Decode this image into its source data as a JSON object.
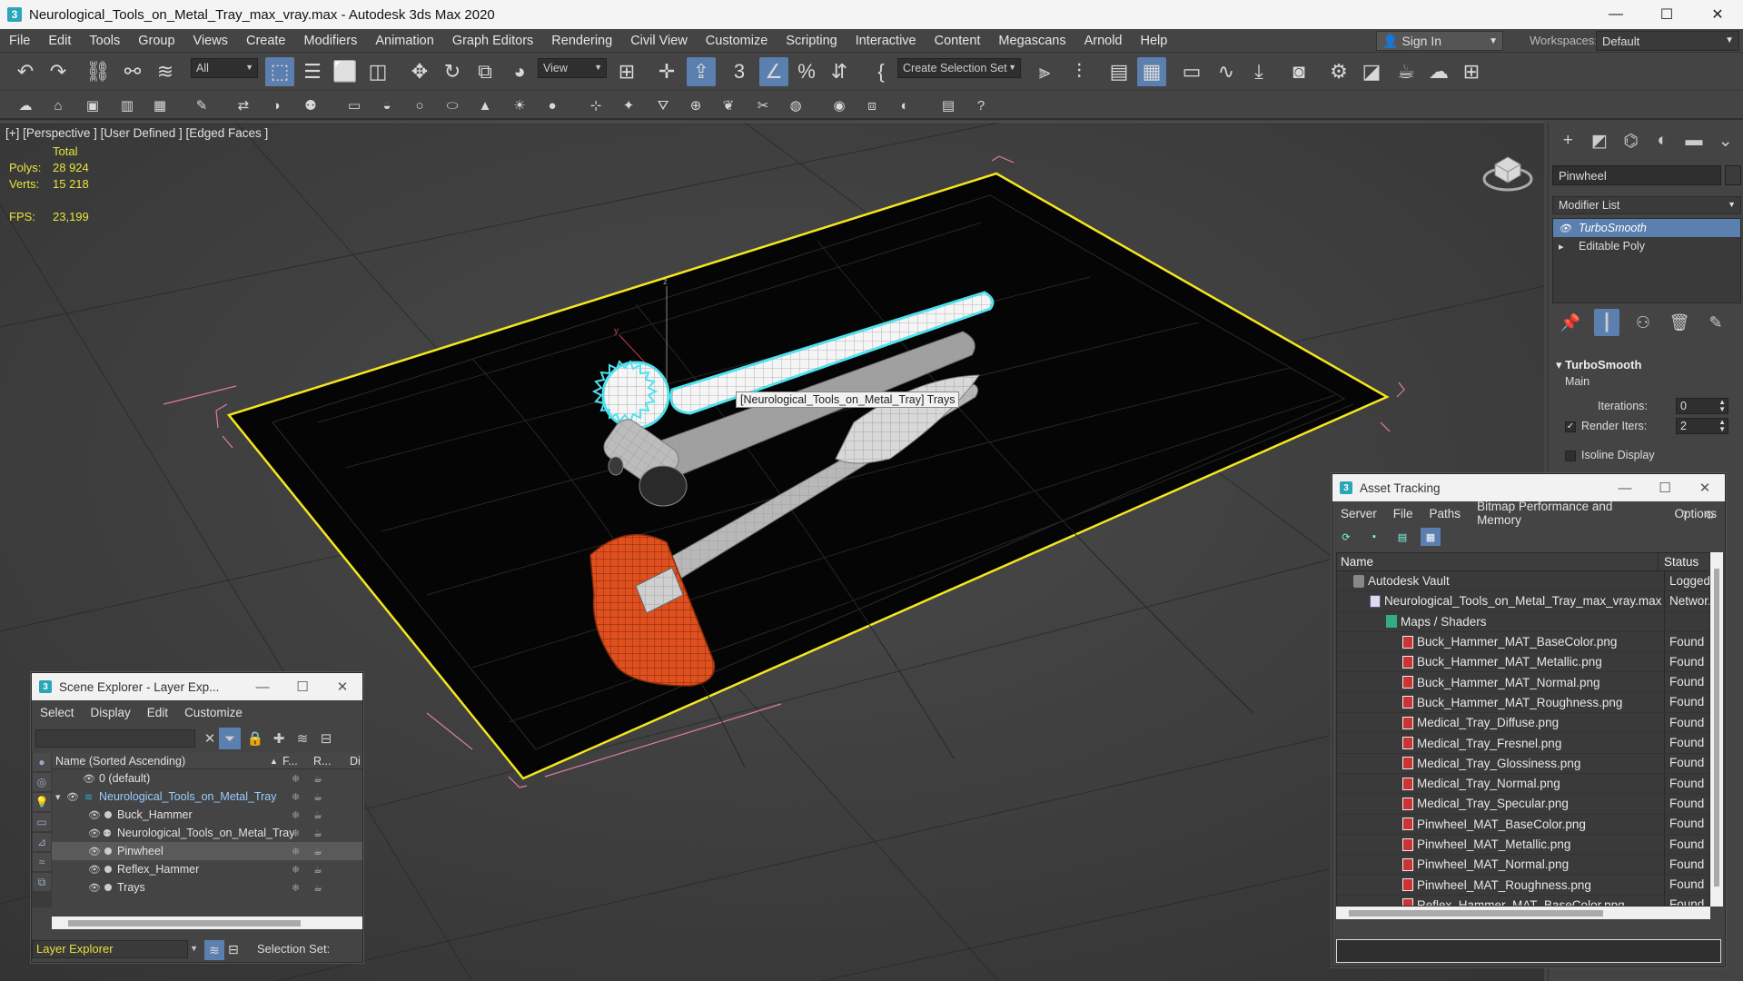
{
  "window": {
    "title": "Neurological_Tools_on_Metal_Tray_max_vray.max - Autodesk 3ds Max 2020",
    "logo": "3",
    "minimize": "—",
    "maximize": "☐",
    "close": "✕"
  },
  "menubar": {
    "items": [
      "File",
      "Edit",
      "Tools",
      "Group",
      "Views",
      "Create",
      "Modifiers",
      "Animation",
      "Graph Editors",
      "Rendering",
      "Civil View",
      "Customize",
      "Scripting",
      "Interactive",
      "Content",
      "Megascans",
      "Arnold",
      "Help"
    ],
    "sign_in": "Sign In",
    "workspaces_label": "Workspaces:",
    "workspace_value": "Default"
  },
  "toolbar": {
    "selection_filter": "All",
    "ref_coord": "View",
    "selection_set": "Create Selection Set"
  },
  "viewport": {
    "label": "[+] [Perspective ] [User Defined ] [Edged Faces ]",
    "stats": {
      "total_label": "Total",
      "polys_label": "Polys:",
      "polys_value": "28 924",
      "verts_label": "Verts:",
      "verts_value": "15 218",
      "fps_label": "FPS:",
      "fps_value": "23,199"
    },
    "tooltip": "[Neurological_Tools_on_Metal_Tray] Trays",
    "colors": {
      "tray_outline": "#f5e61e",
      "selection": "#4fe3f0",
      "hammer_head": "#e0501e",
      "bbox": "#e07aa8"
    }
  },
  "command_panel": {
    "object_name": "Pinwheel",
    "modifier_list": "Modifier List",
    "stack": [
      "TurboSmooth",
      "Editable Poly"
    ],
    "rollout_title": "TurboSmooth",
    "rollout_sub": "Main",
    "iterations_label": "Iterations:",
    "iterations_value": "0",
    "render_iters_label": "Render Iters:",
    "render_iters_value": "2",
    "render_iters_checked": true,
    "isoline_label": "Isoline Display"
  },
  "scene_explorer": {
    "title": "Scene Explorer - Layer Exp...",
    "menu": [
      "Select",
      "Display",
      "Edit",
      "Customize"
    ],
    "header_name": "Name (Sorted Ascending)",
    "header_c1": "F...",
    "header_c2": "R...",
    "header_c3": "Di",
    "rows": [
      {
        "name": "0 (default)",
        "level": 0
      },
      {
        "name": "Neurological_Tools_on_Metal_Tray",
        "level": 0,
        "layer": true
      },
      {
        "name": "Buck_Hammer",
        "level": 1
      },
      {
        "name": "Neurological_Tools_on_Metal_Tray",
        "level": 1
      },
      {
        "name": "Pinwheel",
        "level": 1,
        "selected": true
      },
      {
        "name": "Reflex_Hammer",
        "level": 1
      },
      {
        "name": "Trays",
        "level": 1
      }
    ],
    "layer_explorer": "Layer Explorer",
    "selection_set_label": "Selection Set:"
  },
  "asset_tracking": {
    "title": "Asset Tracking",
    "menu": [
      "Server",
      "File",
      "Paths",
      "Bitmap Performance and Memory",
      "Options"
    ],
    "col_name": "Name",
    "col_status": "Status",
    "rows": [
      {
        "name": "Autodesk Vault",
        "status": "Logged...",
        "indent": 18,
        "icon": "vault"
      },
      {
        "name": "Neurological_Tools_on_Metal_Tray_max_vray.max",
        "status": "Networ...",
        "indent": 36,
        "icon": "max"
      },
      {
        "name": "Maps / Shaders",
        "status": "",
        "indent": 54,
        "icon": "maps"
      },
      {
        "name": "Buck_Hammer_MAT_BaseColor.png",
        "status": "Found",
        "indent": 72,
        "icon": "png"
      },
      {
        "name": "Buck_Hammer_MAT_Metallic.png",
        "status": "Found",
        "indent": 72,
        "icon": "png"
      },
      {
        "name": "Buck_Hammer_MAT_Normal.png",
        "status": "Found",
        "indent": 72,
        "icon": "png"
      },
      {
        "name": "Buck_Hammer_MAT_Roughness.png",
        "status": "Found",
        "indent": 72,
        "icon": "png"
      },
      {
        "name": "Medical_Tray_Diffuse.png",
        "status": "Found",
        "indent": 72,
        "icon": "png"
      },
      {
        "name": "Medical_Tray_Fresnel.png",
        "status": "Found",
        "indent": 72,
        "icon": "png"
      },
      {
        "name": "Medical_Tray_Glossiness.png",
        "status": "Found",
        "indent": 72,
        "icon": "png"
      },
      {
        "name": "Medical_Tray_Normal.png",
        "status": "Found",
        "indent": 72,
        "icon": "png"
      },
      {
        "name": "Medical_Tray_Specular.png",
        "status": "Found",
        "indent": 72,
        "icon": "png"
      },
      {
        "name": "Pinwheel_MAT_BaseColor.png",
        "status": "Found",
        "indent": 72,
        "icon": "png"
      },
      {
        "name": "Pinwheel_MAT_Metallic.png",
        "status": "Found",
        "indent": 72,
        "icon": "png"
      },
      {
        "name": "Pinwheel_MAT_Normal.png",
        "status": "Found",
        "indent": 72,
        "icon": "png"
      },
      {
        "name": "Pinwheel_MAT_Roughness.png",
        "status": "Found",
        "indent": 72,
        "icon": "png"
      },
      {
        "name": "Reflex_Hammer_MAT_BaseColor.png",
        "status": "Found",
        "indent": 72,
        "icon": "png"
      }
    ]
  }
}
